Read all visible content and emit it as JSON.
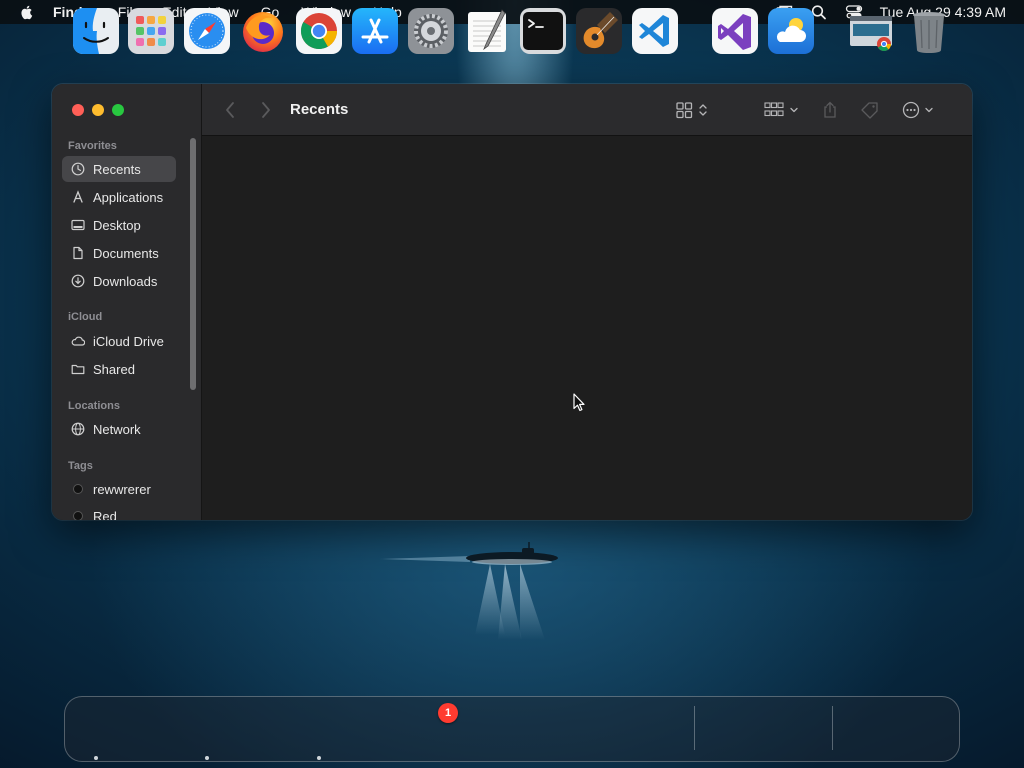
{
  "menubar": {
    "app_name": "Finder",
    "menus": [
      "File",
      "Edit",
      "View",
      "Go",
      "Window",
      "Help"
    ],
    "clock": "Tue Aug 29  4:39 AM",
    "tray_icons": [
      "screen-mirroring-icon",
      "spotlight-icon",
      "control-center-icon"
    ]
  },
  "finder": {
    "title": "Recents",
    "sidebar": {
      "favorites_label": "Favorites",
      "favorites": [
        {
          "label": "Recents",
          "icon": "clock-icon",
          "selected": true
        },
        {
          "label": "Applications",
          "icon": "applications-icon"
        },
        {
          "label": "Desktop",
          "icon": "desktop-icon"
        },
        {
          "label": "Documents",
          "icon": "document-icon"
        },
        {
          "label": "Downloads",
          "icon": "download-icon"
        }
      ],
      "icloud_label": "iCloud",
      "icloud": [
        {
          "label": "iCloud Drive",
          "icon": "cloud-icon"
        },
        {
          "label": "Shared",
          "icon": "shared-folder-icon"
        }
      ],
      "locations_label": "Locations",
      "locations": [
        {
          "label": "Network",
          "icon": "globe-icon"
        }
      ],
      "tags_label": "Tags",
      "tags": [
        {
          "label": "rewwrerer",
          "color": "#111111"
        },
        {
          "label": "Red",
          "color": "#111111"
        }
      ]
    },
    "toolbar_icons": [
      "back-icon",
      "forward-icon",
      "grid-view-icon",
      "group-by-icon",
      "share-icon",
      "tag-icon",
      "more-actions-icon",
      "search-icon"
    ]
  },
  "dock": {
    "apps": [
      "Finder",
      "Launchpad",
      "Safari",
      "Firefox",
      "Google Chrome",
      "App Store",
      "System Settings",
      "TextEdit",
      "Terminal",
      "GarageBand",
      "Visual Studio Code",
      "Visual Studio",
      "Weather",
      "Screenshot",
      "Trash"
    ],
    "settings_badge": "1"
  },
  "colors": {
    "close": "#ff5f57",
    "minimize": "#febc2e",
    "maximize": "#28c840",
    "badge": "#ff3b30"
  }
}
